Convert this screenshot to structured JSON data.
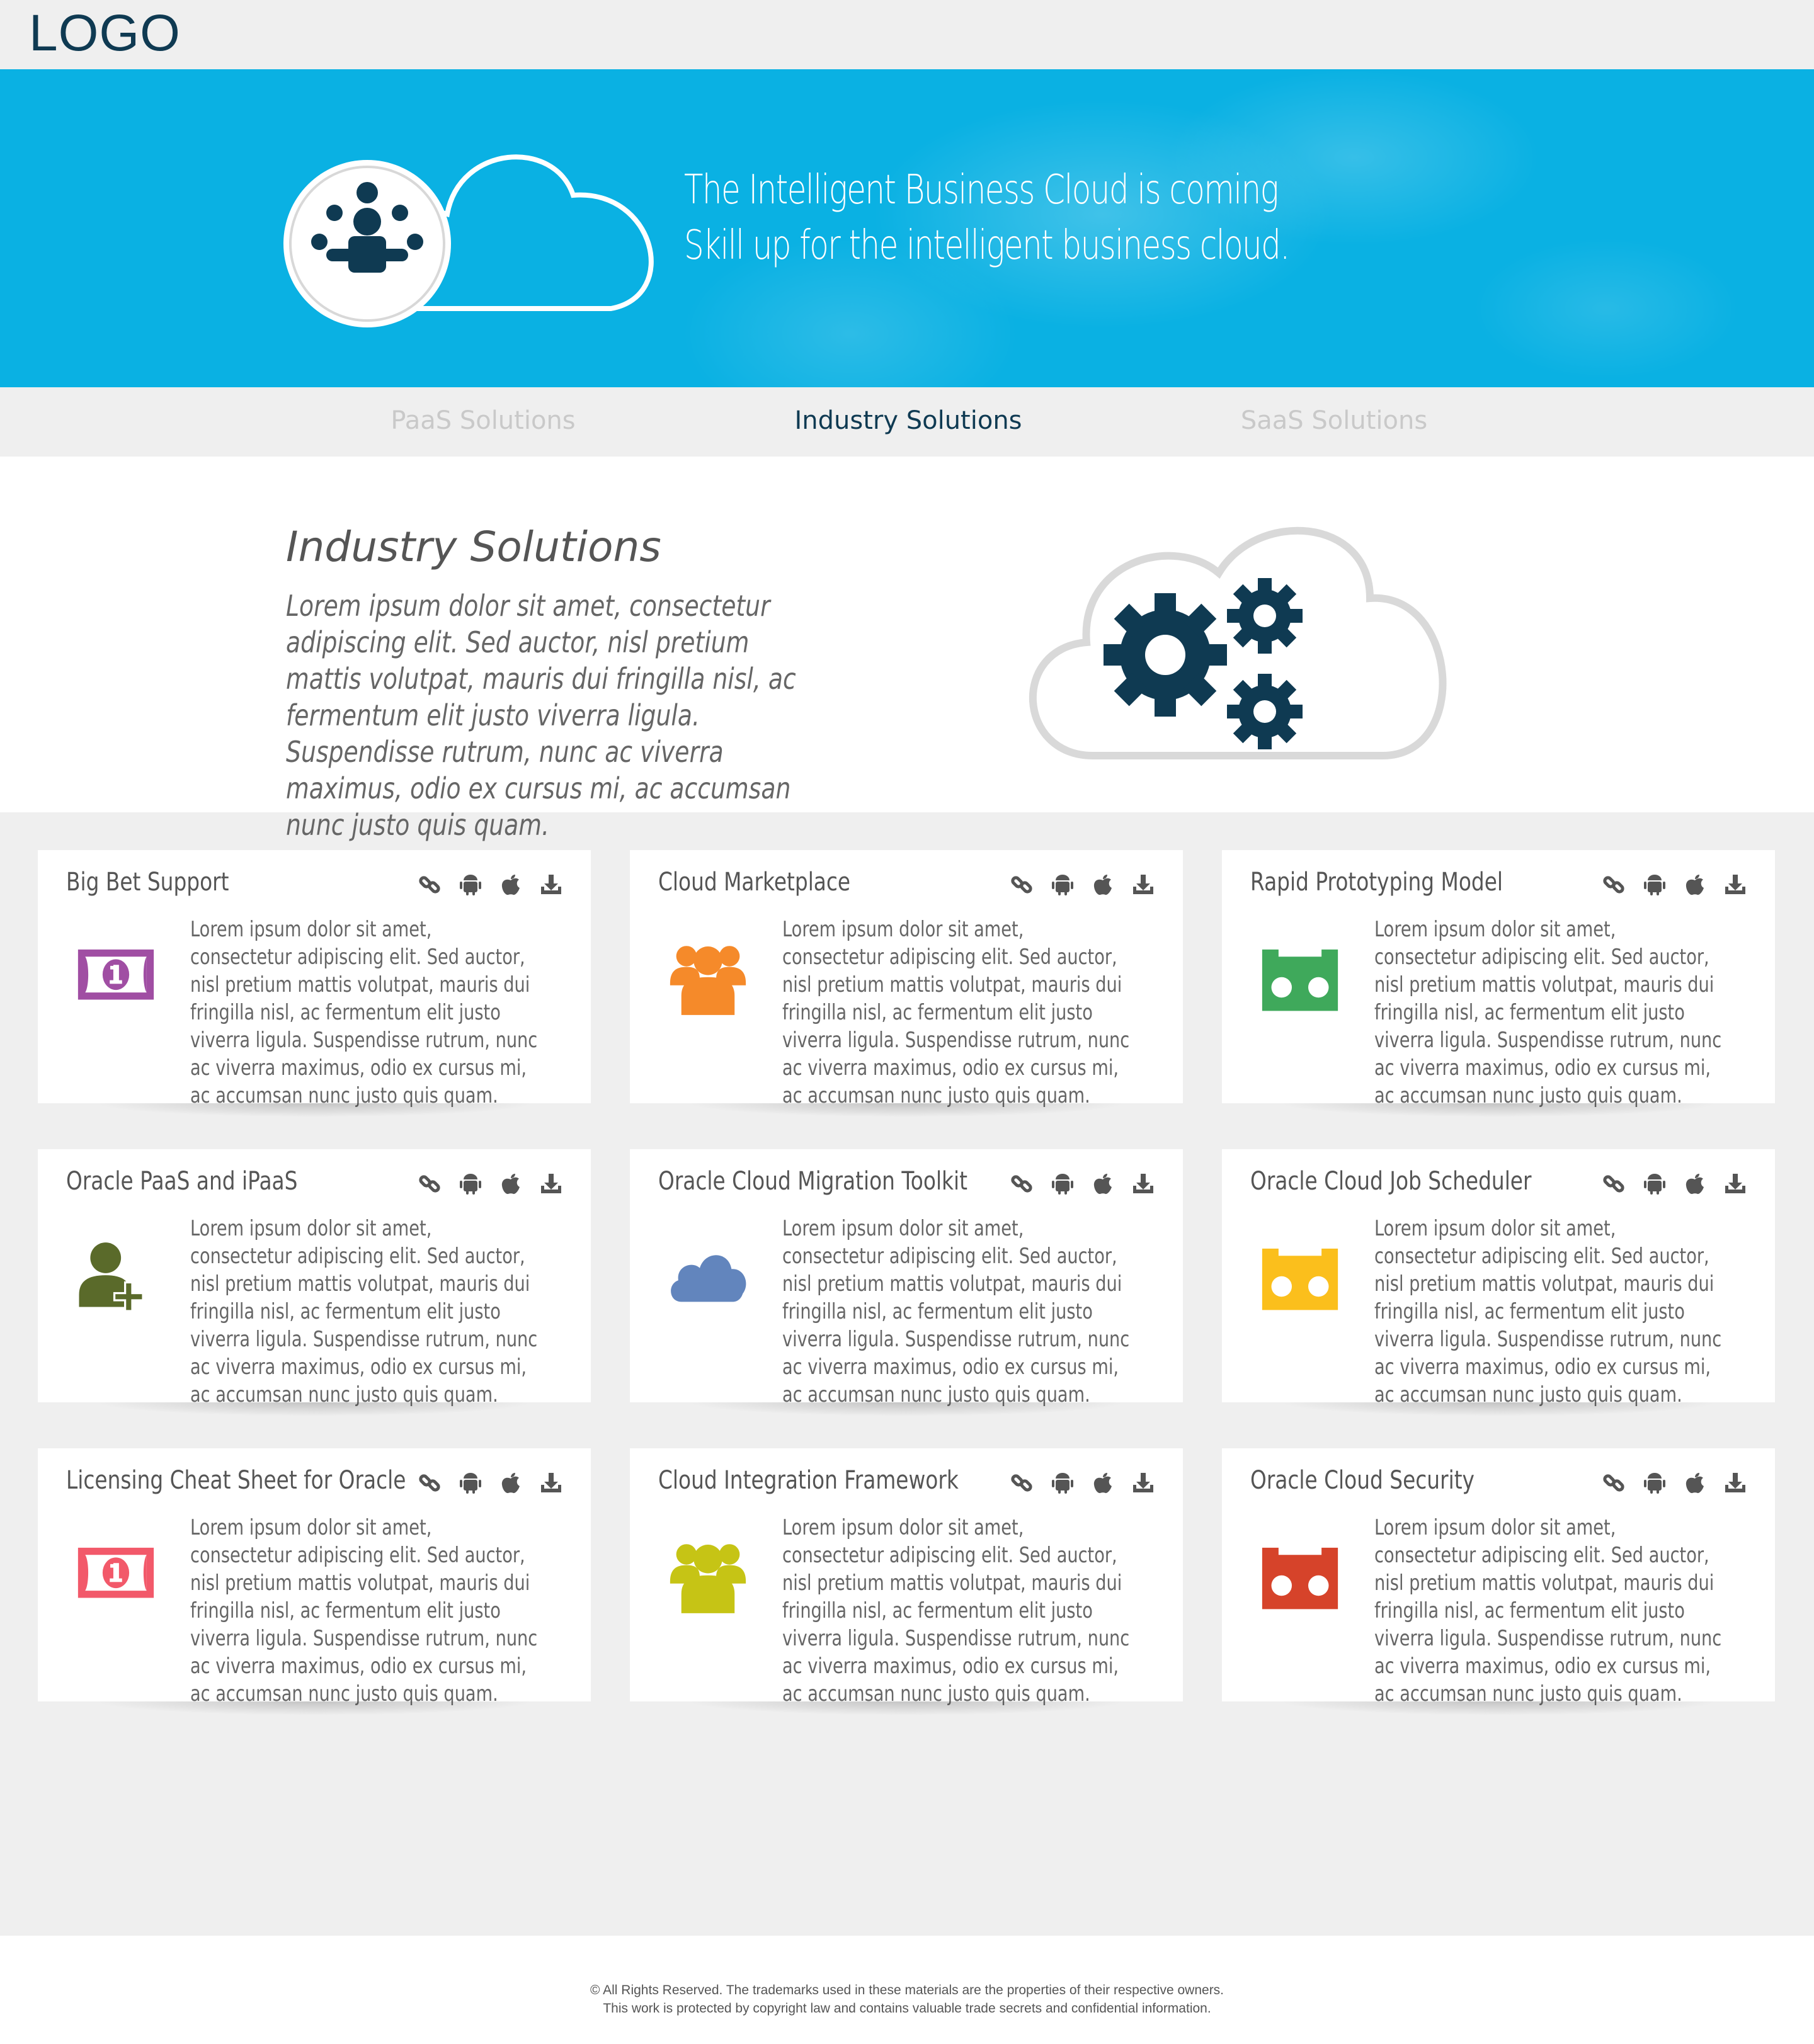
{
  "header": {
    "logo": "LOGO"
  },
  "hero": {
    "line1": "The Intelligent Business Cloud is coming",
    "line2": "Skill up for the intelligent business cloud.",
    "icon": "people-group-cloud-icon"
  },
  "tabs": [
    {
      "label": "PaaS Solutions",
      "active": false
    },
    {
      "label": "Industry Solutions",
      "active": true
    },
    {
      "label": "SaaS Solutions",
      "active": false
    }
  ],
  "intro": {
    "title": "Industry Solutions",
    "body": "Lorem ipsum dolor sit amet, consectetur adipiscing elit. Sed auctor, nisl pretium mattis volutpat, mauris dui fringilla nisl, ac fermentum elit justo viverra ligula. Suspendisse rutrum, nunc ac viverra maximus, odio ex cursus mi, ac accumsan nunc justo quis quam.",
    "icon": "gears-cloud-icon"
  },
  "card_actions": [
    "link-icon",
    "android-icon",
    "apple-icon",
    "download-icon"
  ],
  "cards": [
    {
      "title": "Big Bet Support",
      "icon": "money-bill-icon",
      "color": "#a04ea3",
      "body": "Lorem ipsum dolor sit amet, consectetur adipiscing elit. Sed auctor, nisl pretium mattis volutpat, mauris dui fringilla nisl, ac fermentum elit justo viverra ligula. Suspendisse rutrum, nunc ac viverra maximus, odio ex cursus mi, ac accumsan nunc justo quis quam."
    },
    {
      "title": "Cloud Marketplace",
      "icon": "users-icon",
      "color": "#f58a2a",
      "body": "Lorem ipsum dolor sit amet, consectetur adipiscing elit. Sed auctor, nisl pretium mattis volutpat, mauris dui fringilla nisl, ac fermentum elit justo viverra ligula. Suspendisse rutrum, nunc ac viverra maximus, odio ex cursus mi, ac accumsan nunc justo quis quam."
    },
    {
      "title": "Rapid Prototyping Model",
      "icon": "tape-icon",
      "color": "#3fa95b",
      "body": "Lorem ipsum dolor sit amet, consectetur adipiscing elit. Sed auctor, nisl pretium mattis volutpat, mauris dui fringilla nisl, ac fermentum elit justo viverra ligula. Suspendisse rutrum, nunc ac viverra maximus, odio ex cursus mi, ac accumsan nunc justo quis quam."
    },
    {
      "title": "Oracle PaaS and iPaaS",
      "icon": "user-plus-icon",
      "color": "#5a6a2a",
      "body": "Lorem ipsum dolor sit amet, consectetur adipiscing elit. Sed auctor, nisl pretium mattis volutpat, mauris dui fringilla nisl, ac fermentum elit justo viverra ligula. Suspendisse rutrum, nunc ac viverra maximus, odio ex cursus mi, ac accumsan nunc justo quis quam."
    },
    {
      "title": "Oracle Cloud Migration Toolkit",
      "icon": "cloud-icon",
      "color": "#6285bd",
      "body": "Lorem ipsum dolor sit amet, consectetur adipiscing elit. Sed auctor, nisl pretium mattis volutpat, mauris dui fringilla nisl, ac fermentum elit justo viverra ligula. Suspendisse rutrum, nunc ac viverra maximus, odio ex cursus mi, ac accumsan nunc justo quis quam."
    },
    {
      "title": "Oracle Cloud Job Scheduler",
      "icon": "tape-icon",
      "color": "#fbbf1c",
      "body": "Lorem ipsum dolor sit amet, consectetur adipiscing elit. Sed auctor, nisl pretium mattis volutpat, mauris dui fringilla nisl, ac fermentum elit justo viverra ligula. Suspendisse rutrum, nunc ac viverra maximus, odio ex cursus mi, ac accumsan nunc justo quis quam."
    },
    {
      "title": "Licensing Cheat Sheet for Oracle",
      "icon": "money-bill-icon",
      "color": "#f2596a",
      "body": "Lorem ipsum dolor sit amet, consectetur adipiscing elit. Sed auctor, nisl pretium mattis volutpat, mauris dui fringilla nisl, ac fermentum elit justo viverra ligula. Suspendisse rutrum, nunc ac viverra maximus, odio ex cursus mi, ac accumsan nunc justo quis quam."
    },
    {
      "title": "Cloud Integration Framework",
      "icon": "users-icon",
      "color": "#c6c415",
      "body": "Lorem ipsum dolor sit amet, consectetur adipiscing elit. Sed auctor, nisl pretium mattis volutpat, mauris dui fringilla nisl, ac fermentum elit justo viverra ligula. Suspendisse rutrum, nunc ac viverra maximus, odio ex cursus mi, ac accumsan nunc justo quis quam."
    },
    {
      "title": "Oracle Cloud Security",
      "icon": "tape-icon",
      "color": "#d6432a",
      "body": "Lorem ipsum dolor sit amet, consectetur adipiscing elit. Sed auctor, nisl pretium mattis volutpat, mauris dui fringilla nisl, ac fermentum elit justo viverra ligula. Suspendisse rutrum, nunc ac viverra maximus, odio ex cursus mi, ac accumsan nunc justo quis quam."
    }
  ],
  "footer": {
    "line1": "© All Rights Reserved. The trademarks used in these materials are the properties of their respective owners.",
    "line2": "This work is protected by copyright law and contains valuable trade secrets and confidential information."
  }
}
